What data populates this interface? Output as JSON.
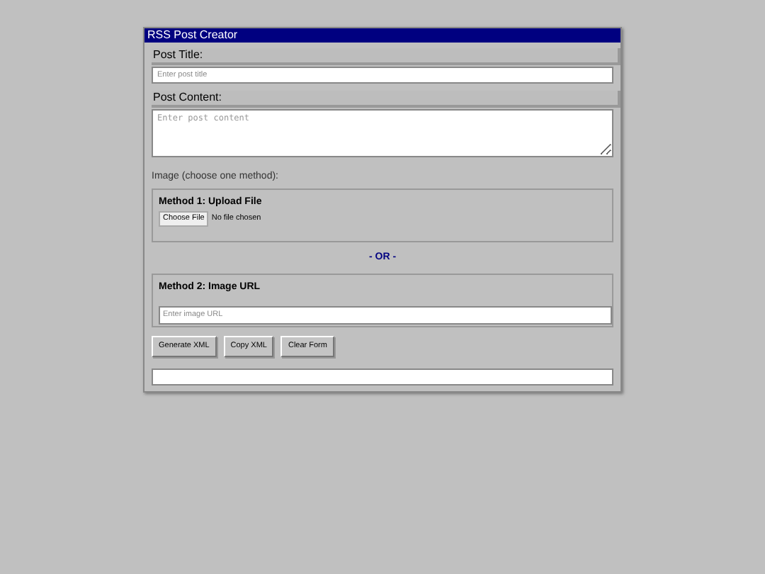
{
  "window": {
    "title": "RSS Post Creator"
  },
  "post_title": {
    "label": "Post Title:",
    "placeholder": "Enter post title"
  },
  "post_content": {
    "label": "Post Content:",
    "placeholder": "Enter post content"
  },
  "image": {
    "label": "Image (choose one method):",
    "method_1": {
      "heading": "Method 1: Upload File",
      "button": "Choose File",
      "status": "No file chosen"
    },
    "separator": "- OR -",
    "method_2": {
      "heading": "Method 2: Image URL",
      "placeholder": "Enter image URL"
    }
  },
  "buttons": [
    "Generate XML",
    "Copy XML",
    "Clear Form"
  ]
}
